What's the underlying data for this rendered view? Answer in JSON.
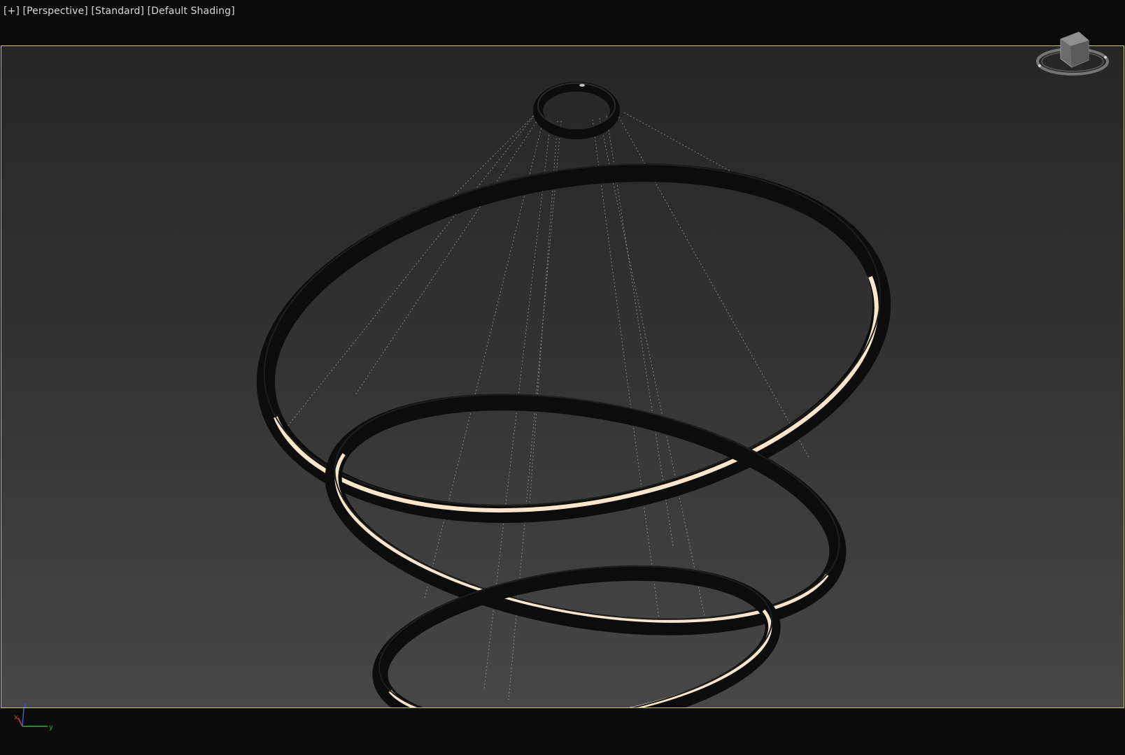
{
  "viewport_label": {
    "plus": "[+]",
    "view": "[Perspective]",
    "mode": "[Standard]",
    "shading": "[Default Shading]"
  },
  "viewcube": {
    "icon": "viewcube-icon"
  },
  "axis_tripod": {
    "x": "x",
    "y": "y",
    "z": "z"
  },
  "colors": {
    "background_top": "#262626",
    "background_bottom": "#474747",
    "viewport_border": "#c9c56a",
    "ring_body": "#0f0f0f",
    "ring_glow": "#fbe6cc",
    "cable": "#bdbdbd"
  },
  "scene": {
    "object": "ring-chandelier",
    "rings": [
      "top-ring",
      "middle-ring",
      "bottom-ring"
    ]
  }
}
